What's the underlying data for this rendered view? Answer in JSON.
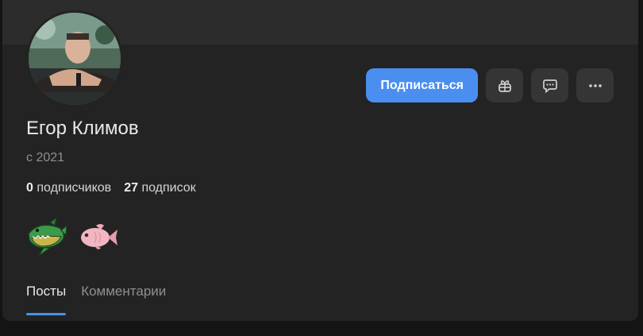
{
  "profile": {
    "name": "Егор Климов",
    "since": "с 2021",
    "followers_count": "0",
    "followers_label": "подписчиков",
    "following_count": "27",
    "following_label": "подписок"
  },
  "actions": {
    "subscribe_label": "Подписаться",
    "icons": [
      "gift-icon",
      "message-icon",
      "more-icon"
    ]
  },
  "badges": [
    "shark-badge",
    "fish-badge"
  ],
  "tabs": [
    {
      "label": "Посты",
      "active": true
    },
    {
      "label": "Комментарии",
      "active": false
    }
  ],
  "colors": {
    "accent": "#4a8ff0",
    "card_bg": "#232323",
    "cover_bg": "#2c2c2c",
    "page_bg": "#141414",
    "icon_button_bg": "#353535"
  }
}
